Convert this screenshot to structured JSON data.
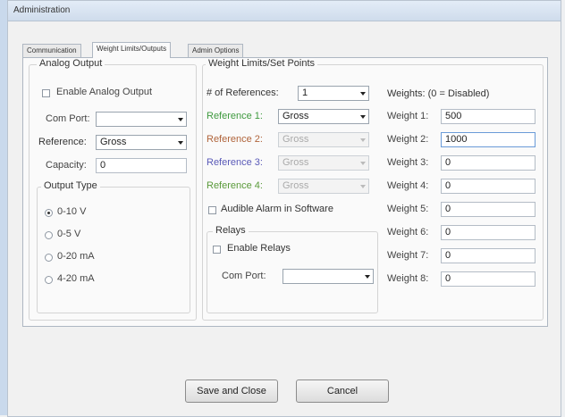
{
  "window": {
    "title": "Administration"
  },
  "tabs": [
    {
      "label": "Communication",
      "active": false
    },
    {
      "label": "Weight Limits/Outputs",
      "active": true
    },
    {
      "label": "Admin Options",
      "active": false
    }
  ],
  "analog": {
    "title": "Analog Output",
    "enable_label": "Enable Analog Output",
    "enable_checked": false,
    "com_port_label": "Com Port:",
    "com_port_value": "",
    "reference_label": "Reference:",
    "reference_value": "Gross",
    "capacity_label": "Capacity:",
    "capacity_value": "0",
    "output_type_title": "Output Type",
    "output_options": [
      "0-10 V",
      "0-5 V",
      "0-20 mA",
      "4-20 mA"
    ],
    "output_selected": "0-10 V"
  },
  "limits": {
    "title": "Weight Limits/Set Points",
    "num_refs_label": "# of References:",
    "num_refs_value": "1",
    "references": [
      {
        "label": "Reference 1:",
        "value": "Gross",
        "color": "#3f9a3f"
      },
      {
        "label": "Reference 2:",
        "value": "Gross",
        "color": "#b0643b"
      },
      {
        "label": "Reference 3:",
        "value": "Gross",
        "color": "#5a5ab8"
      },
      {
        "label": "Reference 4:",
        "value": "Gross",
        "color": "#5a9a3a"
      }
    ],
    "audible_label": "Audible Alarm in Software",
    "audible_checked": false,
    "relays_title": "Relays",
    "enable_relays_label": "Enable Relays",
    "enable_relays_checked": false,
    "relays_com_port_label": "Com Port:",
    "relays_com_port_value": ""
  },
  "weights": {
    "header": "Weights: (0 = Disabled)",
    "items": [
      {
        "label": "Weight 1:",
        "value": "500"
      },
      {
        "label": "Weight 2:",
        "value": "1000"
      },
      {
        "label": "Weight 3:",
        "value": "0"
      },
      {
        "label": "Weight 4:",
        "value": "0"
      },
      {
        "label": "Weight 5:",
        "value": "0"
      },
      {
        "label": "Weight 6:",
        "value": "0"
      },
      {
        "label": "Weight 7:",
        "value": "0"
      },
      {
        "label": "Weight 8:",
        "value": "0"
      }
    ]
  },
  "buttons": {
    "save_close": "Save and Close",
    "cancel": "Cancel"
  }
}
